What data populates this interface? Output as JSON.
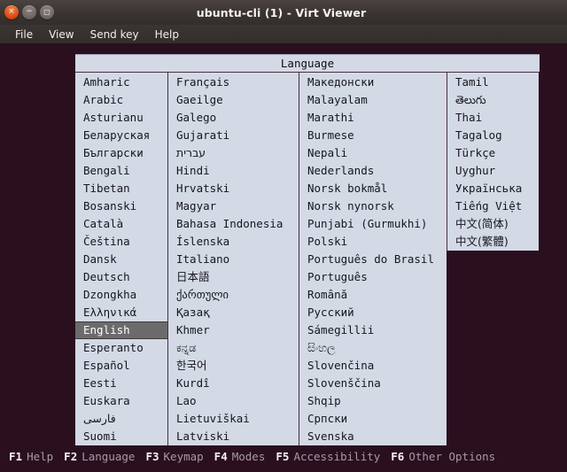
{
  "window": {
    "title": "ubuntu-cli (1) - Virt Viewer",
    "buttons": {
      "close": "×",
      "minimize": "−",
      "maximize": "□"
    }
  },
  "menu": {
    "items": [
      "File",
      "View",
      "Send key",
      "Help"
    ]
  },
  "dialog": {
    "header": "Language",
    "selected": "English",
    "columns": [
      {
        "name": "column-1",
        "items": [
          "Amharic",
          "Arabic",
          "Asturianu",
          "Беларуская",
          "Български",
          "Bengali",
          "Tibetan",
          "Bosanski",
          "Català",
          "Čeština",
          "Dansk",
          "Deutsch",
          "Dzongkha",
          "Ελληνικά",
          "English",
          "Esperanto",
          "Español",
          "Eesti",
          "Euskara",
          "فارسی",
          "Suomi"
        ]
      },
      {
        "name": "column-2",
        "items": [
          "Français",
          "Gaeilge",
          "Galego",
          "Gujarati",
          "עברית",
          "Hindi",
          "Hrvatski",
          "Magyar",
          "Bahasa Indonesia",
          "Íslenska",
          "Italiano",
          "日本語",
          "ქართული",
          "Қазақ",
          "Khmer",
          "ಕನ್ನಡ",
          "한국어",
          "Kurdî",
          "Lao",
          "Lietuviškai",
          "Latviski"
        ]
      },
      {
        "name": "column-3",
        "items": [
          "Македонски",
          "Malayalam",
          "Marathi",
          "Burmese",
          "Nepali",
          "Nederlands",
          "Norsk bokmål",
          "Norsk nynorsk",
          "Punjabi (Gurmukhi)",
          "Polski",
          "Português do Brasil",
          "Português",
          "Română",
          "Русский",
          "Sámegillii",
          "සිංහල",
          "Slovenčina",
          "Slovenščina",
          "Shqip",
          "Српски",
          "Svenska"
        ]
      },
      {
        "name": "column-4",
        "items": [
          "Tamil",
          "తెలుగు",
          "Thai",
          "Tagalog",
          "Türkçe",
          "Uyghur",
          "Українська",
          "Tiếng Việt",
          "中文(简体)",
          "中文(繁體)"
        ]
      }
    ]
  },
  "fkeys": [
    {
      "key": "F1",
      "label": "Help"
    },
    {
      "key": "F2",
      "label": "Language"
    },
    {
      "key": "F3",
      "label": "Keymap"
    },
    {
      "key": "F4",
      "label": "Modes"
    },
    {
      "key": "F5",
      "label": "Accessibility"
    },
    {
      "key": "F6",
      "label": "Other Options"
    }
  ],
  "colors": {
    "terminal_bg": "#2a0f1f",
    "dialog_bg": "#d4d9e6",
    "selection_bg": "#6b6b6b",
    "selection_fg": "#ffffff",
    "titlebar_bg": "#3b3532",
    "close_button": "#dd4814"
  }
}
